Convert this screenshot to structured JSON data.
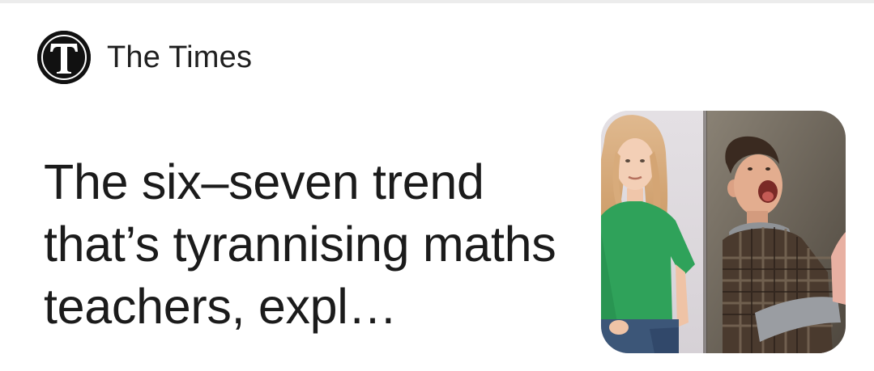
{
  "source": {
    "name": "The Times",
    "logo_icon": "times-t-logo",
    "logo_letter": "T"
  },
  "article": {
    "headline": "The six–seven trend that’s tyrannising maths teachers, expl…",
    "thumbnail_icon": "article-photo"
  },
  "colors": {
    "logo_background": "#111111",
    "headline_text": "#1b1b1b",
    "divider": "#ececec"
  }
}
